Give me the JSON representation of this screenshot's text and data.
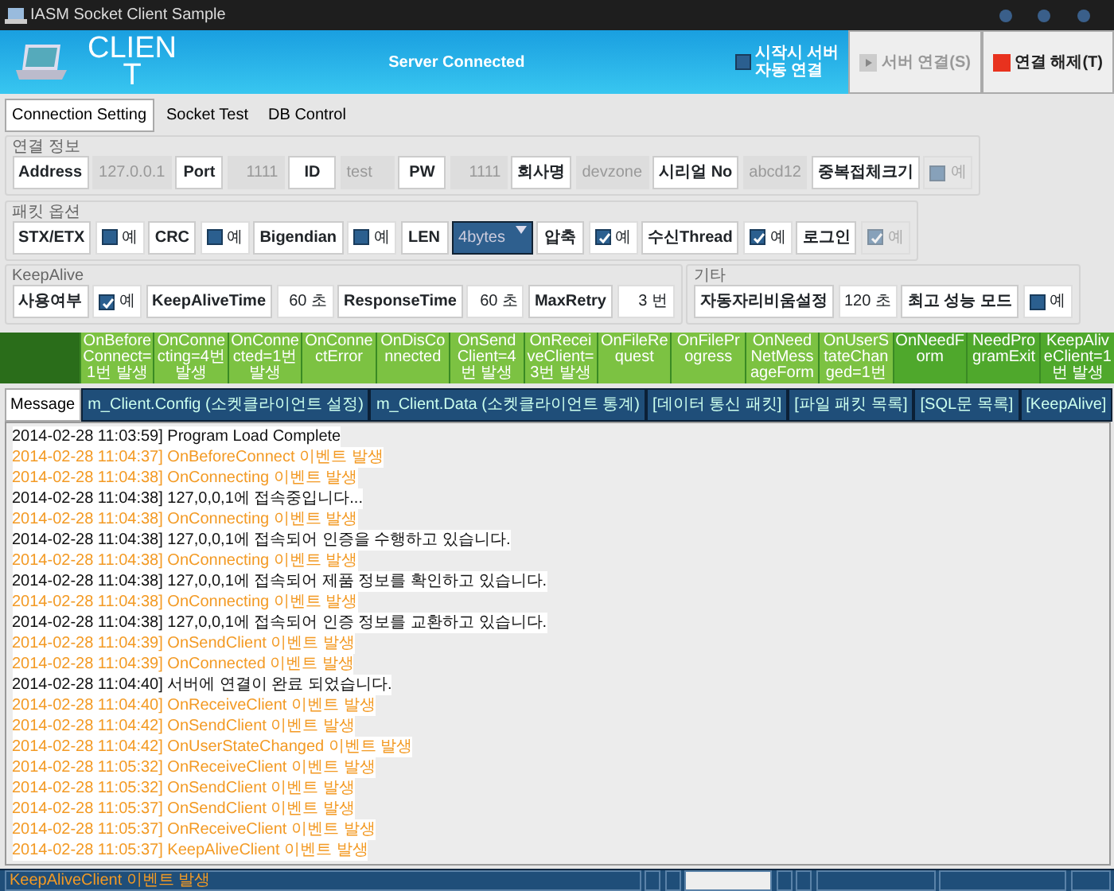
{
  "window": {
    "title": "IASM Socket Client Sample"
  },
  "header": {
    "logo_text": "CLIENT",
    "status": "Server Connected",
    "auto_connect": {
      "label": "시작시 서버 자동 연결",
      "checked": false
    },
    "buttons": [
      {
        "label": "서버 연결(S)",
        "disabled": true
      },
      {
        "label": "연결 해제(T)",
        "disabled": false
      }
    ]
  },
  "tabs": [
    {
      "label": "Connection Setting",
      "selected": true
    },
    {
      "label": "Socket Test",
      "selected": false
    },
    {
      "label": "DB Control",
      "selected": false
    }
  ],
  "groups": [
    {
      "title": "연결 정보",
      "items": [
        {
          "kind": "label",
          "text": "Address"
        },
        {
          "kind": "value",
          "text": "127.0.0.1",
          "disabled": true
        },
        {
          "kind": "label",
          "text": "Port"
        },
        {
          "kind": "number",
          "text": "1111",
          "disabled": true
        },
        {
          "kind": "label",
          "text": "ID"
        },
        {
          "kind": "value",
          "text": "test",
          "disabled": true
        },
        {
          "kind": "label",
          "text": "PW"
        },
        {
          "kind": "number",
          "text": "1111",
          "disabled": true
        },
        {
          "kind": "label",
          "text": "회사명"
        },
        {
          "kind": "value",
          "text": "devzone",
          "disabled": true
        },
        {
          "kind": "label",
          "text": "시리얼 No"
        },
        {
          "kind": "value",
          "text": "abcd12",
          "disabled": true
        },
        {
          "kind": "label",
          "text": "중복접체크기"
        },
        {
          "kind": "check",
          "text": "예",
          "checked": false,
          "disabled": true
        }
      ]
    },
    {
      "title": "패킷 옵션",
      "items": [
        {
          "kind": "label",
          "text": "STX/ETX"
        },
        {
          "kind": "check",
          "text": "예",
          "checked": false,
          "disabled": false
        },
        {
          "kind": "label",
          "text": "CRC"
        },
        {
          "kind": "check",
          "text": "예",
          "checked": false,
          "disabled": false
        },
        {
          "kind": "label",
          "text": "Bigendian"
        },
        {
          "kind": "check",
          "text": "예",
          "checked": false,
          "disabled": false
        },
        {
          "kind": "label",
          "text": "LEN"
        },
        {
          "kind": "select",
          "text": "4bytes"
        },
        {
          "kind": "label",
          "text": "압축"
        },
        {
          "kind": "check",
          "text": "예",
          "checked": true,
          "disabled": false
        },
        {
          "kind": "label",
          "text": "수신Thread"
        },
        {
          "kind": "check",
          "text": "예",
          "checked": true,
          "disabled": false
        },
        {
          "kind": "label",
          "text": "로그인"
        },
        {
          "kind": "check",
          "text": "예",
          "checked": true,
          "disabled": true
        }
      ]
    },
    {
      "title": "KeepAlive",
      "items": [
        {
          "kind": "label",
          "text": "사용여부"
        },
        {
          "kind": "check",
          "text": "예",
          "checked": true,
          "disabled": false
        },
        {
          "kind": "label",
          "text": "KeepAliveTime"
        },
        {
          "kind": "number",
          "text": "60 초",
          "disabled": false
        },
        {
          "kind": "label",
          "text": "ResponseTime"
        },
        {
          "kind": "number",
          "text": "60 초",
          "disabled": false
        },
        {
          "kind": "label",
          "text": "MaxRetry"
        },
        {
          "kind": "number",
          "text": "3 번",
          "disabled": false
        }
      ]
    },
    {
      "title": "기타",
      "items": [
        {
          "kind": "label",
          "text": "자동자리비움설정"
        },
        {
          "kind": "number",
          "text": "120 초",
          "disabled": false
        },
        {
          "kind": "label",
          "text": "최고 성능 모드"
        },
        {
          "kind": "check",
          "text": "예",
          "checked": false,
          "disabled": false
        }
      ]
    }
  ],
  "events": [
    {
      "text": "OnBeforeConnect=1번 발생",
      "color": "#7cc242"
    },
    {
      "text": "OnConnecting=4번 발생",
      "color": "#7cc242"
    },
    {
      "text": "OnConnected=1번 발생",
      "color": "#7cc242"
    },
    {
      "text": "OnConnectError",
      "color": "#7cc242"
    },
    {
      "text": "OnDisConnected",
      "color": "#7cc242"
    },
    {
      "text": "OnSendClient=4번 발생",
      "color": "#7cc242"
    },
    {
      "text": "OnReceiveClient=3번 발생",
      "color": "#7cc242"
    },
    {
      "text": "OnFileRequest",
      "color": "#7cc242"
    },
    {
      "text": "OnFileProgress",
      "color": "#7cc242"
    },
    {
      "text": "OnNeedNetMessageForm",
      "color": "#7cc242"
    },
    {
      "text": "OnUserStateChanged=1번",
      "color": "#7cc242"
    },
    {
      "text": "OnNeedForm",
      "color": "#4fa82c"
    },
    {
      "text": "NeedProgramExit",
      "color": "#4fa82c"
    },
    {
      "text": "KeepAliveClient=1번 발생",
      "color": "#4fa82c"
    }
  ],
  "log_tabs": [
    {
      "label": "Message",
      "selected": true
    },
    {
      "label": "m_Client.Config (소켓클라이언트 설정)",
      "selected": false
    },
    {
      "label": "m_Client.Data (소켓클라이언트 통계)",
      "selected": false
    },
    {
      "label": "[데이터 통신 패킷]",
      "selected": false
    },
    {
      "label": "[파일 패킷 목록]",
      "selected": false
    },
    {
      "label": "[SQL문 목록]",
      "selected": false
    },
    {
      "label": "[KeepAlive]",
      "selected": false
    }
  ],
  "log": [
    {
      "kind": "info",
      "text": "2014-02-28 11:03:59] Program Load Complete"
    },
    {
      "kind": "event",
      "text": "2014-02-28 11:04:37] OnBeforeConnect 이벤트 발생"
    },
    {
      "kind": "event",
      "text": "2014-02-28 11:04:38] OnConnecting 이벤트 발생"
    },
    {
      "kind": "info",
      "text": "2014-02-28 11:04:38] 127,0,0,1에 접속중입니다..."
    },
    {
      "kind": "event",
      "text": "2014-02-28 11:04:38] OnConnecting 이벤트 발생"
    },
    {
      "kind": "info",
      "text": "2014-02-28 11:04:38] 127,0,0,1에 접속되어 인증을 수행하고 있습니다."
    },
    {
      "kind": "event",
      "text": "2014-02-28 11:04:38] OnConnecting 이벤트 발생"
    },
    {
      "kind": "info",
      "text": "2014-02-28 11:04:38] 127,0,0,1에 접속되어 제품 정보를 확인하고 있습니다."
    },
    {
      "kind": "event",
      "text": "2014-02-28 11:04:38] OnConnecting 이벤트 발생"
    },
    {
      "kind": "info",
      "text": "2014-02-28 11:04:38] 127,0,0,1에 접속되어 인증 정보를 교환하고 있습니다."
    },
    {
      "kind": "event",
      "text": "2014-02-28 11:04:39] OnSendClient 이벤트 발생"
    },
    {
      "kind": "event",
      "text": "2014-02-28 11:04:39] OnConnected 이벤트 발생"
    },
    {
      "kind": "info",
      "text": "2014-02-28 11:04:40] 서버에 연결이 완료 되었습니다."
    },
    {
      "kind": "event",
      "text": "2014-02-28 11:04:40] OnReceiveClient 이벤트 발생"
    },
    {
      "kind": "event",
      "text": "2014-02-28 11:04:42] OnSendClient 이벤트 발생"
    },
    {
      "kind": "event",
      "text": "2014-02-28 11:04:42] OnUserStateChanged 이벤트 발생"
    },
    {
      "kind": "event",
      "text": "2014-02-28 11:05:32] OnReceiveClient 이벤트 발생"
    },
    {
      "kind": "event",
      "text": "2014-02-28 11:05:32] OnSendClient 이벤트 발생"
    },
    {
      "kind": "event",
      "text": "2014-02-28 11:05:37] OnSendClient 이벤트 발생"
    },
    {
      "kind": "event",
      "text": "2014-02-28 11:05:37] OnReceiveClient 이벤트 발생"
    },
    {
      "kind": "event",
      "text": "2014-02-28 11:05:37] KeepAliveClient 이벤트 발생"
    }
  ],
  "status_bar": {
    "text": "KeepAliveClient 이벤트 발생"
  }
}
